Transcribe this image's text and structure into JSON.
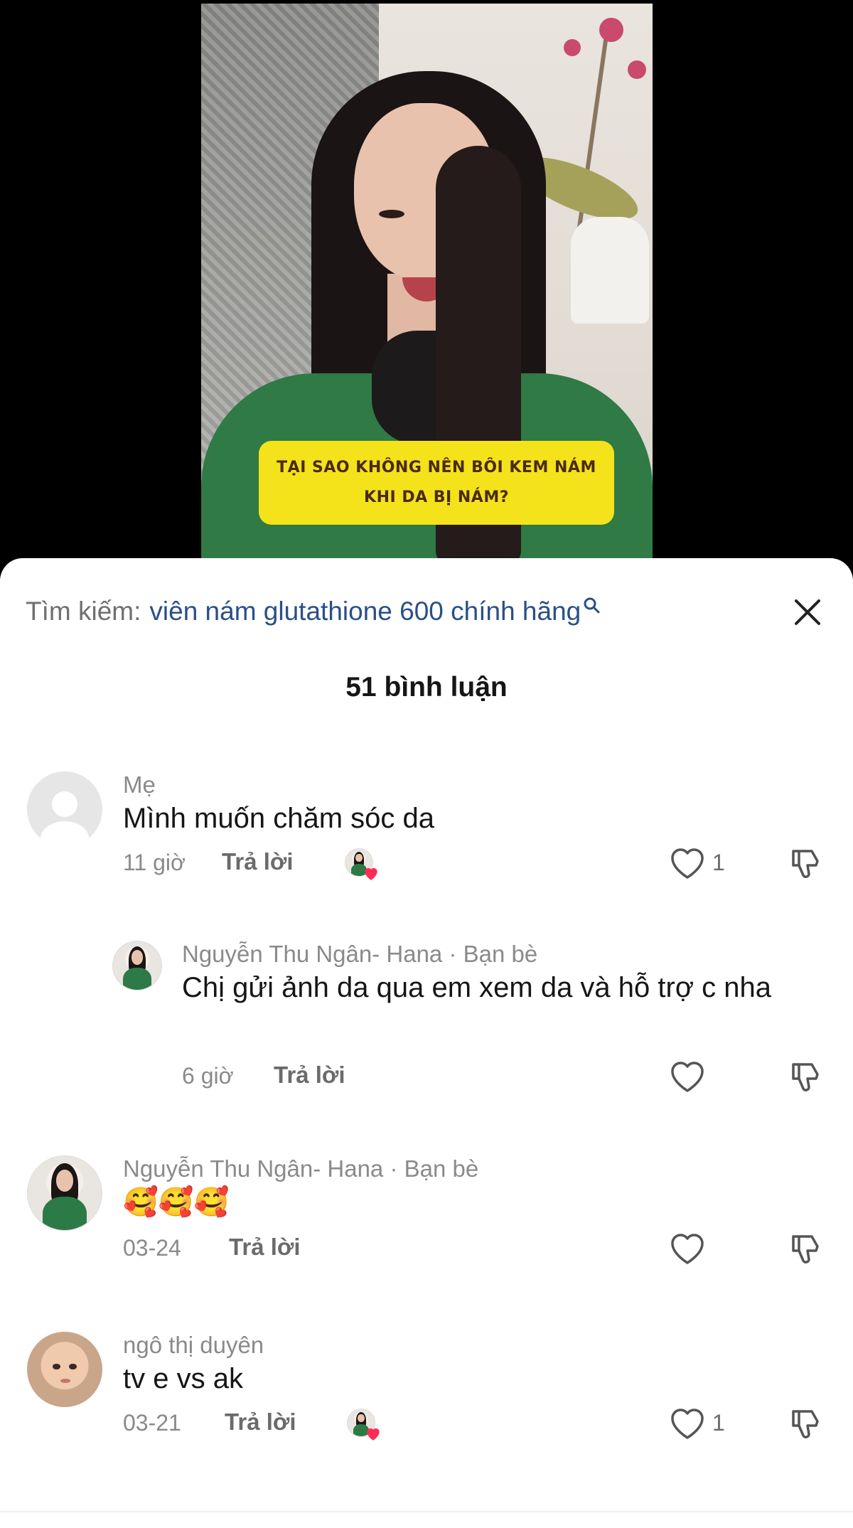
{
  "video": {
    "caption_line1": "TẠI SAO KHÔNG NÊN BÔI KEM NÁM",
    "caption_line2": "KHI DA BỊ NÁM?"
  },
  "search": {
    "prefix": "Tìm kiếm:",
    "query": "viên nám glutathione 600 chính hãng",
    "icon": "search-icon"
  },
  "close_icon": "close-icon",
  "comments_count_label": "51 bình luận",
  "comments": [
    {
      "name": "Mẹ",
      "text": "Mình muốn chăm sóc da",
      "time": "11 giờ",
      "reply_label": "Trả lời",
      "liked_by_creator": true,
      "like_count": "1",
      "avatar": "default-avatar"
    },
    {
      "name": "Nguyễn Thu Ngân- Hana · Bạn bè",
      "text": "Chị gửi ảnh da qua em xem da và hỗ trợ c nha",
      "time": "6 giờ",
      "reply_label": "Trả lời",
      "liked_by_creator": false,
      "like_count": "",
      "avatar": "creator-avatar",
      "is_reply": true
    },
    {
      "name": "Nguyễn Thu Ngân- Hana · Bạn bè",
      "text": "🥰🥰🥰",
      "time": "03-24",
      "reply_label": "Trả lời",
      "liked_by_creator": false,
      "like_count": "",
      "avatar": "creator-avatar"
    },
    {
      "name": "ngô thị duyên",
      "text": "tv e vs ak",
      "time": "03-21",
      "reply_label": "Trả lời",
      "liked_by_creator": true,
      "like_count": "1",
      "avatar": "baby-avatar"
    }
  ],
  "colors": {
    "search_query": "#2a4f87",
    "muted_text": "#8a8a8a",
    "creator_heart": "#fe2c55",
    "caption_bg": "#f4e21b"
  }
}
